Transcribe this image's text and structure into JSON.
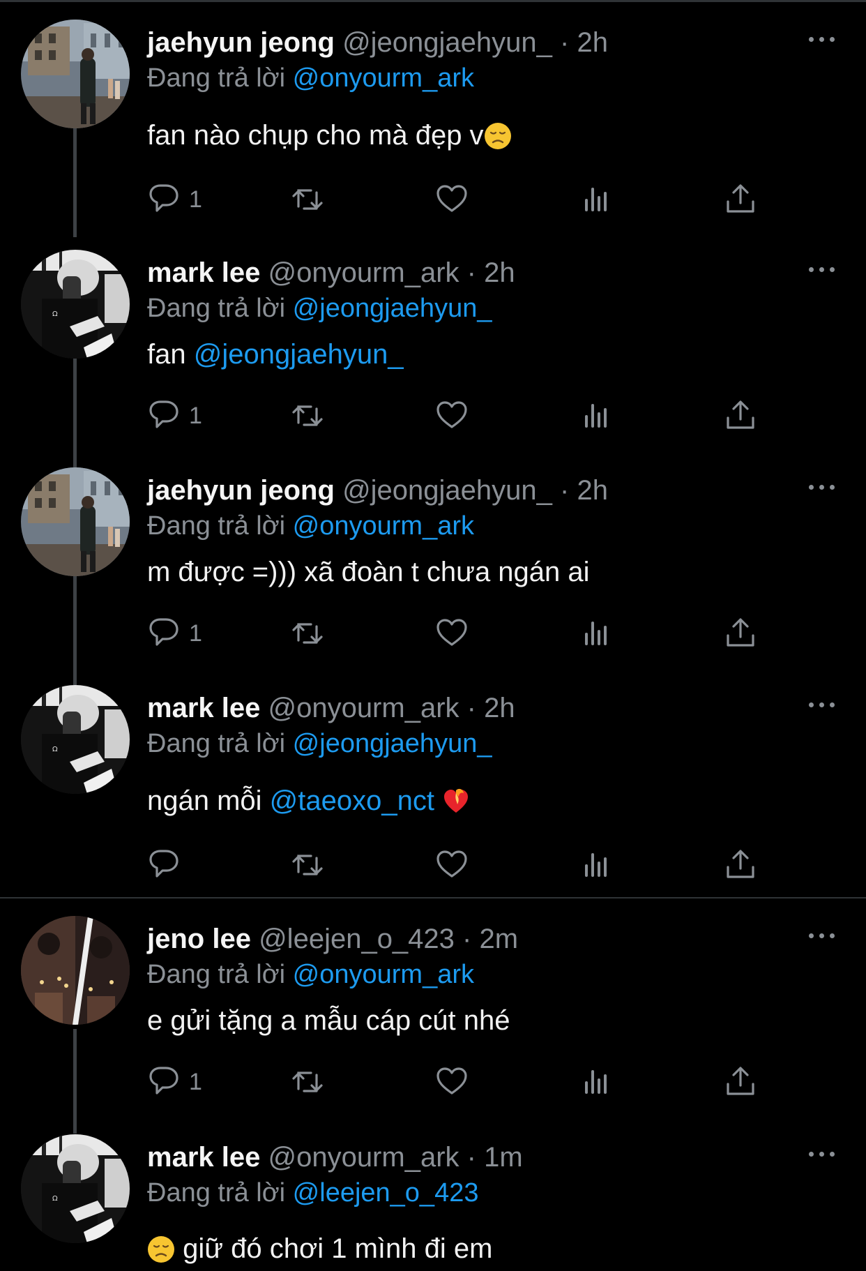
{
  "reply_prefix": "Đang trả lời",
  "tweets": [
    {
      "name": "jaehyun jeong",
      "handle": "@jeongjaehyun_",
      "sep": "·",
      "time": "2h",
      "reply_to": "@onyourm_ark",
      "text_before": "fan nào chụp cho mà đẹp v",
      "mention_in_text": "",
      "text_after": "",
      "emoji": "disappointed-face",
      "reply_count": "1",
      "avatar": "street-photo"
    },
    {
      "name": "mark lee",
      "handle": "@onyourm_ark",
      "sep": "·",
      "time": "2h",
      "reply_to": "@jeongjaehyun_",
      "text_before": "fan ",
      "mention_in_text": "@jeongjaehyun_",
      "text_after": "",
      "emoji": "",
      "reply_count": "1",
      "avatar": "bw-selfie"
    },
    {
      "name": "jaehyun jeong",
      "handle": "@jeongjaehyun_",
      "sep": "·",
      "time": "2h",
      "reply_to": "@onyourm_ark",
      "text_before": "m được =))) xã đoàn t chưa ngán ai",
      "mention_in_text": "",
      "text_after": "",
      "emoji": "",
      "reply_count": "1",
      "avatar": "street-photo"
    },
    {
      "name": "mark lee",
      "handle": "@onyourm_ark",
      "sep": "·",
      "time": "2h",
      "reply_to": "@jeongjaehyun_",
      "text_before": "ngán mỗi ",
      "mention_in_text": "@taeoxo_nct",
      "text_after": " ",
      "emoji": "heart-on-fire",
      "reply_count": "",
      "avatar": "bw-selfie"
    },
    {
      "name": "jeno lee",
      "handle": "@leejen_o_423",
      "sep": "·",
      "time": "2m",
      "reply_to": "@onyourm_ark",
      "text_before": "e gửi tặng a mẫu cáp cút nhé",
      "mention_in_text": "",
      "text_after": "",
      "emoji": "",
      "reply_count": "1",
      "avatar": "couple-collage"
    },
    {
      "name": "mark lee",
      "handle": "@onyourm_ark",
      "sep": "·",
      "time": "1m",
      "reply_to": "@leejen_o_423",
      "text_before": " giữ đó chơi 1 mình đi em",
      "mention_in_text": "",
      "text_after": "",
      "emoji": "disappointed-face-leading",
      "reply_count": "",
      "avatar": "bw-selfie"
    }
  ],
  "icons": {
    "reply": "reply-icon",
    "retweet": "retweet-icon",
    "like": "like-icon",
    "views": "views-icon",
    "share": "share-icon",
    "more": "more-icon"
  },
  "colors": {
    "background": "#000000",
    "text": "#f2f2f2",
    "secondary": "#8b9096",
    "mention": "#1d9bf0",
    "divider": "#2f3336"
  }
}
